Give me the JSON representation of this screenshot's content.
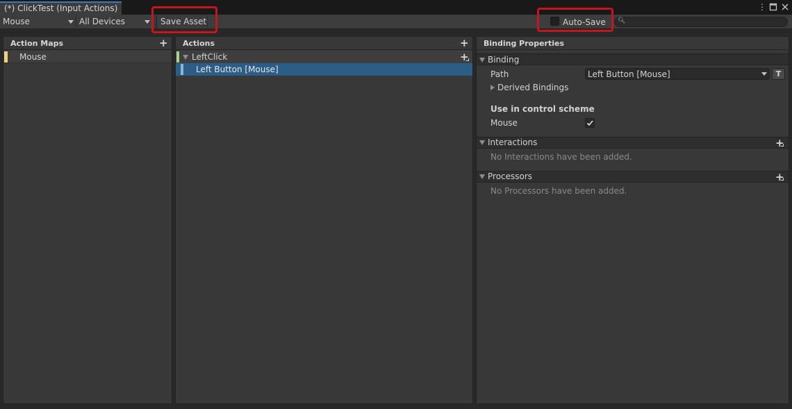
{
  "window": {
    "tab_title": "(*) ClickTest (Input Actions)",
    "menu_icon": "kebab-menu-icon",
    "maximize_icon": "maximize-icon",
    "close_icon": "close-icon"
  },
  "toolbar": {
    "control_scheme": "Mouse",
    "device": "All Devices",
    "save_asset": "Save Asset",
    "auto_save_label": "Auto-Save",
    "auto_save_checked": false,
    "search_placeholder": ""
  },
  "action_maps": {
    "header": "Action Maps",
    "items": [
      {
        "label": "Mouse",
        "selected": true
      }
    ]
  },
  "actions": {
    "header": "Actions",
    "items": [
      {
        "label": "LeftClick",
        "bindings": [
          {
            "label": "Left Button [Mouse]",
            "selected": true
          }
        ]
      }
    ]
  },
  "binding_properties": {
    "header": "Binding Properties",
    "binding_section": "Binding",
    "path_label": "Path",
    "path_value": "Left Button [Mouse]",
    "text_mode_button": "T",
    "derived_bindings": "Derived Bindings",
    "control_scheme_heading": "Use in control scheme",
    "control_scheme_name": "Mouse",
    "control_scheme_checked": true,
    "interactions_section": "Interactions",
    "interactions_empty": "No Interactions have been added.",
    "processors_section": "Processors",
    "processors_empty": "No Processors have been added."
  },
  "colors": {
    "selection": "#2c5d87",
    "highlight_box": "#c4161c",
    "action_map_marker": "#f2d17b",
    "action_marker": "#a8d08d",
    "binding_marker": "#8ab4d8",
    "tab_accent": "#3a79bb"
  }
}
